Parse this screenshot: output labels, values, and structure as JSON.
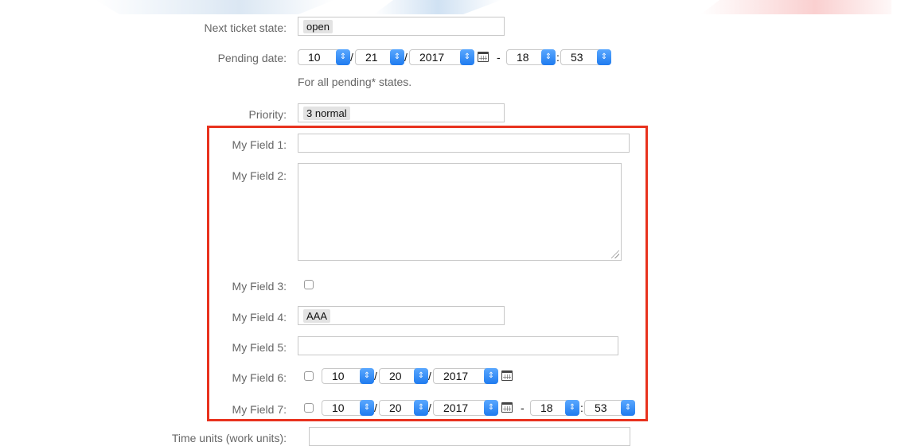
{
  "form": {
    "next_state": {
      "label": "Next ticket state:",
      "value": "open"
    },
    "pending_date": {
      "label": "Pending date:",
      "month": "10",
      "day": "21",
      "year": "2017",
      "hour": "18",
      "minute": "53",
      "hint": "For all pending* states."
    },
    "priority": {
      "label": "Priority:",
      "value": "3 normal"
    },
    "dynamic_fields": {
      "field1": {
        "label": "My Field 1:",
        "value": ""
      },
      "field2": {
        "label": "My Field 2:",
        "value": ""
      },
      "field3": {
        "label": "My Field 3:",
        "checked": false
      },
      "field4": {
        "label": "My Field 4:",
        "value": "AAA"
      },
      "field5": {
        "label": "My Field 5:",
        "value": ""
      },
      "field6": {
        "label": "My Field 6:",
        "checked": false,
        "month": "10",
        "day": "20",
        "year": "2017"
      },
      "field7": {
        "label": "My Field 7:",
        "checked": false,
        "month": "10",
        "day": "20",
        "year": "2017",
        "hour": "18",
        "minute": "53"
      }
    },
    "time_units": {
      "label": "Time units (work units):",
      "value": ""
    }
  },
  "separators": {
    "slash": "/",
    "dash": "-",
    "colon": ":"
  },
  "icons": {
    "spinner": "up-down-chevron-icon",
    "calendar": "calendar-icon"
  },
  "colors": {
    "highlight_border": "#e8321e",
    "spinner_blue": "#1f7bef"
  }
}
